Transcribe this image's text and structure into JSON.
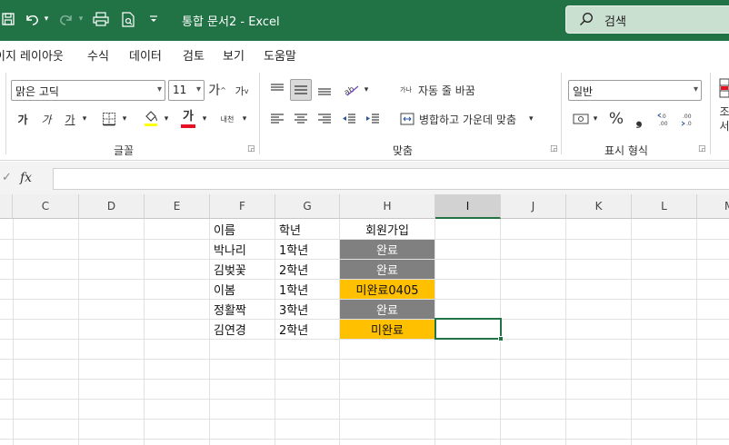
{
  "titlebar": {
    "title": "통합 문서2  -  Excel",
    "search_placeholder": "검색",
    "accent": "#217346"
  },
  "menu": {
    "items": [
      "이지 레이아웃",
      "수식",
      "데이터",
      "검토",
      "보기",
      "도움말"
    ]
  },
  "ribbon": {
    "font": {
      "font_name": "맑은 고딕",
      "font_size": "11",
      "grow_label": "가",
      "shrink_label": "가",
      "bold_label": "가",
      "italic_label": "가",
      "underline_label": "가",
      "font_color_label": "가",
      "phonetic_label": "내천",
      "group_label": "글꼴"
    },
    "alignment": {
      "wrap_label": "자동 줄 바꿈",
      "merge_label": "병합하고 가운데 맞춤",
      "wrap_icon_label": "가나",
      "group_label": "맞춤"
    },
    "number": {
      "format": "일반",
      "percent_label": "%",
      "comma_label": "❟",
      "group_label": "표시 형식"
    },
    "cut_label_1": "조",
    "cut_label_2": "서"
  },
  "formula_bar": {
    "fx_label": "fx",
    "value": ""
  },
  "grid": {
    "columns": [
      "C",
      "D",
      "E",
      "F",
      "G",
      "H",
      "I",
      "J",
      "K",
      "L",
      "M"
    ],
    "selected_column": "I",
    "header_row": {
      "name": "이름",
      "grade": "학년",
      "member": "회원가입"
    },
    "rows": [
      {
        "name": "박나리",
        "grade": "1학년",
        "member": "완료"
      },
      {
        "name": "김벚꽃",
        "grade": "2학년",
        "member": "완료"
      },
      {
        "name": "이봄",
        "grade": "1학년",
        "member": "미완료0405"
      },
      {
        "name": "정활짝",
        "grade": "3학년",
        "member": "완료"
      },
      {
        "name": "김연경",
        "grade": "2학년",
        "member": "미완료"
      }
    ],
    "fill_colors": {
      "complete": "#808080",
      "incomplete": "#ffc000"
    }
  }
}
